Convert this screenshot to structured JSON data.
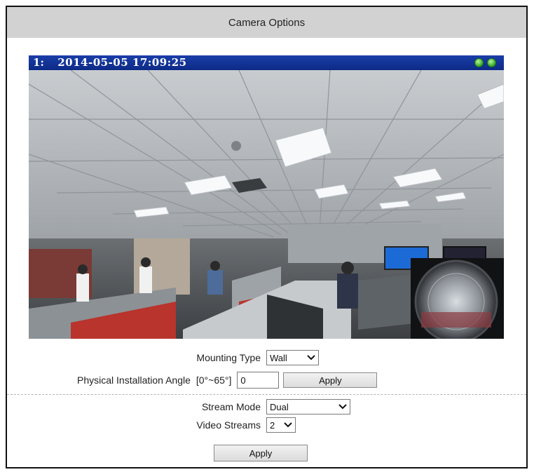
{
  "panel": {
    "title": "Camera Options"
  },
  "viewer": {
    "channel": "1:",
    "timestamp": "2014-05-05 17:09:25",
    "status_indicators": [
      "green",
      "green"
    ]
  },
  "mounting": {
    "label": "Mounting Type",
    "selected": "Wall"
  },
  "angle": {
    "label": "Physical Installation Angle",
    "range": "[0°~65°]",
    "value": "0",
    "apply_label": "Apply"
  },
  "stream_mode": {
    "label": "Stream Mode",
    "selected": "Dual"
  },
  "video_streams": {
    "label": "Video Streams",
    "selected": "2"
  },
  "footer": {
    "apply_label": "Apply"
  },
  "colors": {
    "title_bar": "#d2d2d2",
    "osd_bar": "#1a3ea8",
    "status_green": "#2fa521"
  }
}
